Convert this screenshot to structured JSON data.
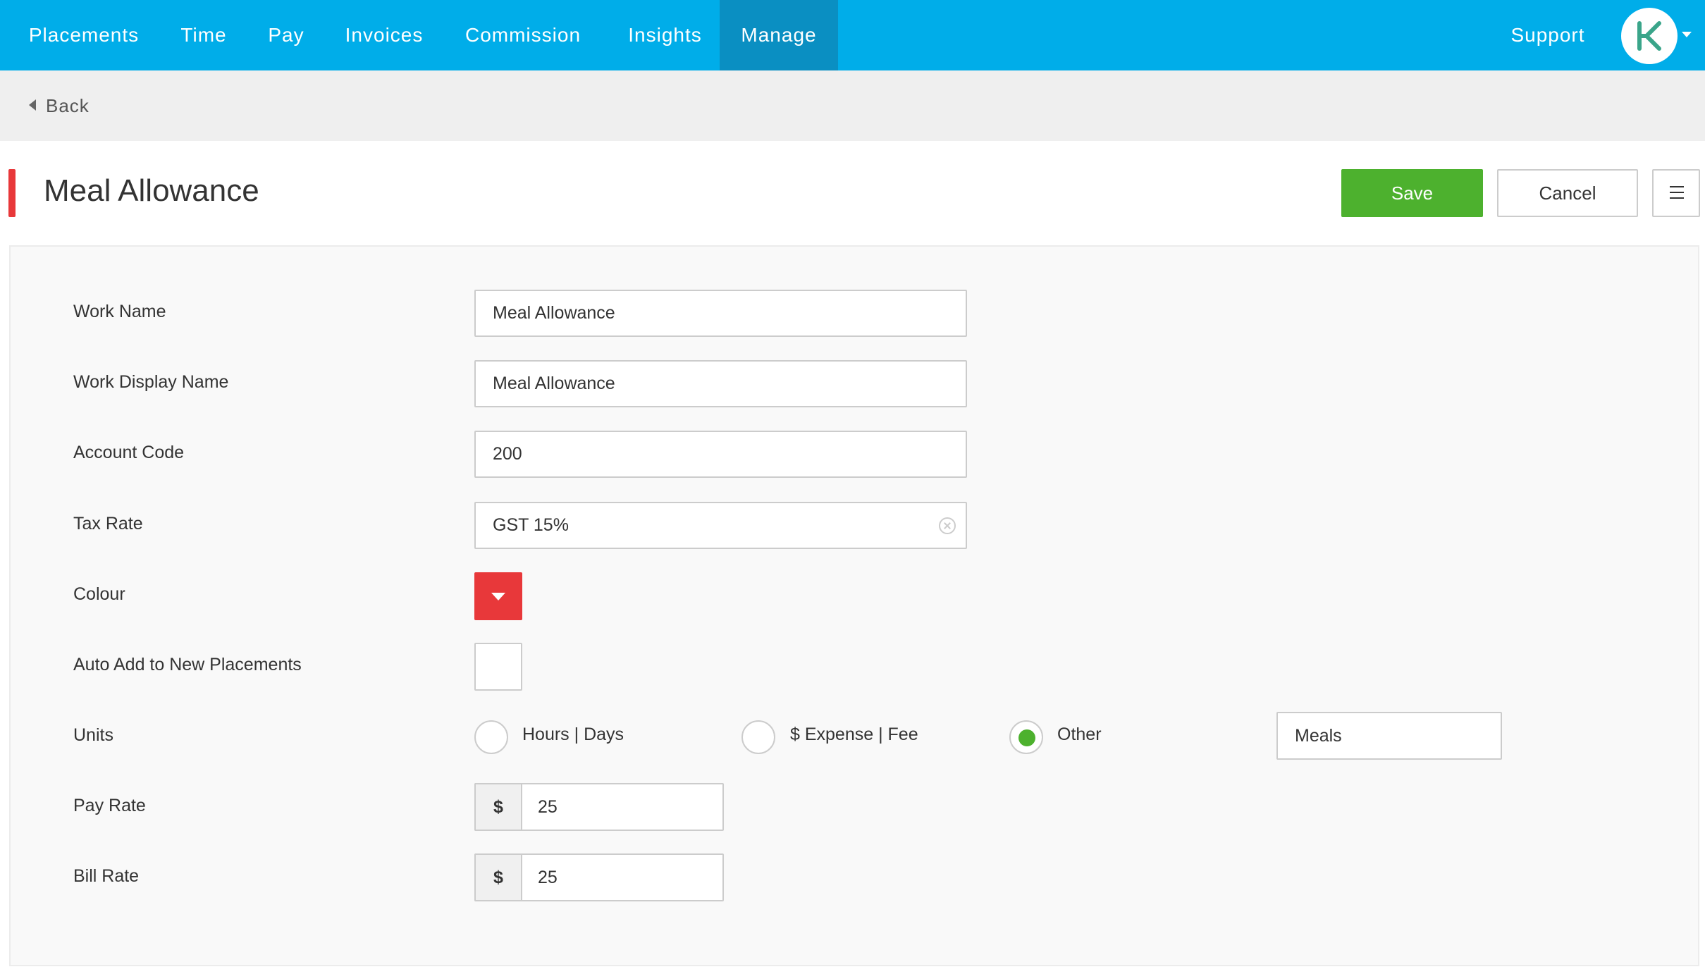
{
  "nav": {
    "items": [
      {
        "label": "Placements"
      },
      {
        "label": "Time"
      },
      {
        "label": "Pay"
      },
      {
        "label": "Invoices"
      },
      {
        "label": "Commission"
      },
      {
        "label": "Insights"
      },
      {
        "label": "Manage",
        "active": true
      }
    ],
    "support_label": "Support",
    "accent_color": "#00ade9",
    "active_color": "#0a8fc2"
  },
  "backbar": {
    "back_label": "Back"
  },
  "header": {
    "title": "Meal Allowance",
    "save_label": "Save",
    "cancel_label": "Cancel",
    "menu_icon": "hamburger-icon"
  },
  "form": {
    "work_name": {
      "label": "Work Name",
      "value": "Meal Allowance"
    },
    "work_display_name": {
      "label": "Work Display Name",
      "value": "Meal Allowance"
    },
    "account_code": {
      "label": "Account Code",
      "value": "200"
    },
    "tax_rate": {
      "label": "Tax Rate",
      "value": "GST 15%"
    },
    "colour": {
      "label": "Colour",
      "value": "#e8383a"
    },
    "auto_add": {
      "label": "Auto Add to New Placements",
      "checked": false
    },
    "units": {
      "label": "Units",
      "options": [
        {
          "label": "Hours | Days",
          "selected": false
        },
        {
          "label": "$ Expense | Fee",
          "selected": false
        },
        {
          "label": "Other",
          "selected": true
        }
      ],
      "other_value": "Meals",
      "selected_color": "#4db12e"
    },
    "pay_rate": {
      "label": "Pay Rate",
      "currency": "$",
      "value": "25"
    },
    "bill_rate": {
      "label": "Bill Rate",
      "currency": "$",
      "value": "25"
    }
  }
}
